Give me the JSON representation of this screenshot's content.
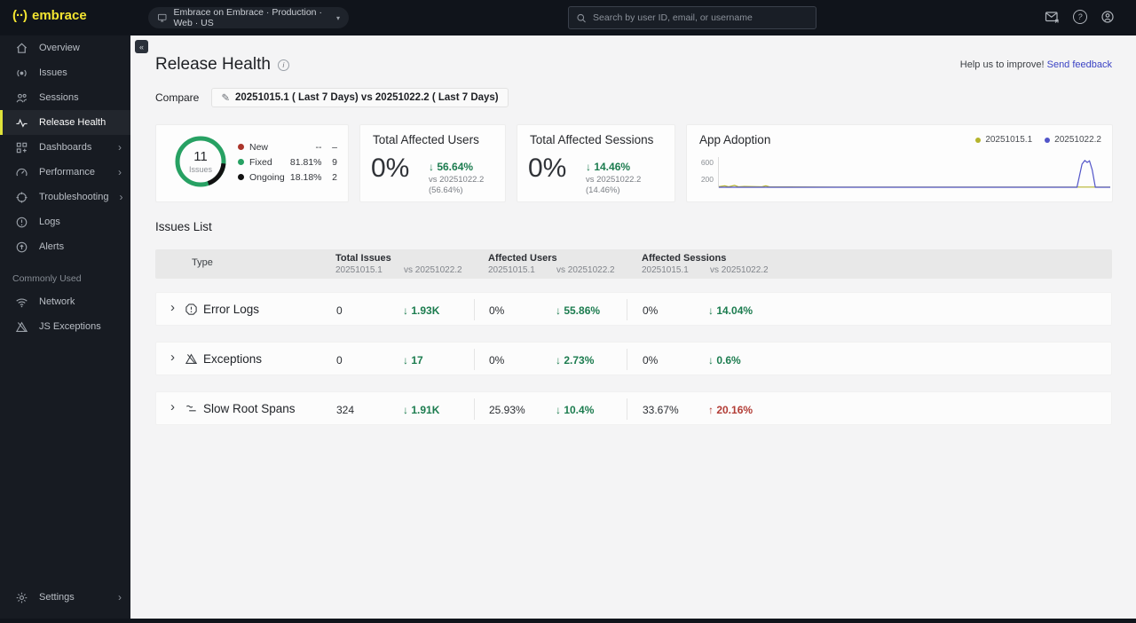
{
  "ui": {
    "chevron_glyph": "›",
    "collapse_glyph": "«",
    "pencil_glyph": "✎",
    "help_glyph": "?",
    "info_glyph": "i",
    "caret_glyph": "▾"
  },
  "topbar": {
    "logo_mark": "(··)",
    "logo_text": "embrace",
    "app_selector_text": "Embrace on Embrace · Production · Web · US",
    "search_placeholder": "Search by user ID, email, or username"
  },
  "sidebar": {
    "items": [
      {
        "label": "Overview",
        "icon": "home-icon"
      },
      {
        "label": "Issues",
        "icon": "radar-icon"
      },
      {
        "label": "Sessions",
        "icon": "users-icon"
      },
      {
        "label": "Release Health",
        "icon": "pulse-icon",
        "active": true
      },
      {
        "label": "Dashboards",
        "icon": "dashboards-grid-icon",
        "chevron": true
      },
      {
        "label": "Performance",
        "icon": "gauge-icon",
        "chevron": true
      },
      {
        "label": "Troubleshooting",
        "icon": "crosshair-icon",
        "chevron": true
      },
      {
        "label": "Logs",
        "icon": "alert-circle-icon"
      },
      {
        "label": "Alerts",
        "icon": "alert-target-icon"
      }
    ],
    "section_label": "Commonly Used",
    "common_items": [
      {
        "label": "Network",
        "icon": "wifi-icon"
      },
      {
        "label": "JS Exceptions",
        "icon": "warning-triangle-icon"
      }
    ],
    "settings_label": "Settings"
  },
  "page": {
    "title": "Release Health",
    "feedback_text": "Help us to improve!",
    "feedback_link": "Send feedback",
    "compare_label": "Compare",
    "compare_value": "20251015.1 ( Last 7 Days) vs 20251022.2 ( Last 7 Days)"
  },
  "cards": {
    "issues": {
      "center_value": "11",
      "center_label": "Issues",
      "legend": [
        {
          "label": "New",
          "pct": "--",
          "count": "–",
          "color": "#ab352b"
        },
        {
          "label": "Fixed",
          "pct": "81.81%",
          "count": "9",
          "color": "#27a163"
        },
        {
          "label": "Ongoing",
          "pct": "18.18%",
          "count": "2",
          "color": "#121212"
        }
      ]
    },
    "affected_users": {
      "title": "Total Affected Users",
      "value": "0%",
      "delta": "↓ 56.64%",
      "vs": "vs 20251022.2 (56.64%)"
    },
    "affected_sessions": {
      "title": "Total Affected Sessions",
      "value": "0%",
      "delta": "↓ 14.46%",
      "vs": "vs 20251022.2 (14.46%)"
    },
    "app_adoption": {
      "title": "App Adoption",
      "legend": [
        {
          "label": "20251015.1",
          "color": "#b5b42c"
        },
        {
          "label": "20251022.2",
          "color": "#5154c8"
        }
      ],
      "y_ticks": [
        "600",
        "200"
      ]
    }
  },
  "chart_data": {
    "type": "line",
    "title": "App Adoption",
    "xlabel": "",
    "ylabel": "",
    "ylim": [
      0,
      700
    ],
    "y_ticks": [
      200,
      600
    ],
    "grid": false,
    "legend_position": "top-right",
    "series": [
      {
        "name": "20251015.1",
        "color": "#b5b42c",
        "points": [
          [
            0,
            25
          ],
          [
            1.5,
            45
          ],
          [
            2.5,
            20
          ],
          [
            4,
            55
          ],
          [
            5,
            20
          ],
          [
            6.5,
            30
          ],
          [
            11,
            20
          ],
          [
            12,
            45
          ],
          [
            13,
            18
          ],
          [
            30,
            14
          ],
          [
            60,
            14
          ],
          [
            100,
            14
          ]
        ]
      },
      {
        "name": "20251022.2",
        "color": "#5154c8",
        "points": [
          [
            0,
            10
          ],
          [
            50,
            10
          ],
          [
            91.5,
            10
          ],
          [
            92.8,
            560
          ],
          [
            93.5,
            645
          ],
          [
            94.1,
            600
          ],
          [
            94.7,
            635
          ],
          [
            95.4,
            420
          ],
          [
            96.2,
            10
          ],
          [
            100,
            10
          ]
        ]
      }
    ]
  },
  "issues_list": {
    "title": "Issues List",
    "header": {
      "type": "Type",
      "groups": [
        {
          "label": "Total Issues",
          "col1": "20251015.1",
          "col2": "vs 20251022.2"
        },
        {
          "label": "Affected Users",
          "col1": "20251015.1",
          "col2": "vs 20251022.2"
        },
        {
          "label": "Affected Sessions",
          "col1": "20251015.1",
          "col2": "vs 20251022.2"
        }
      ]
    },
    "rows": [
      {
        "label": "Error Logs",
        "icon": "error-octagon-icon",
        "total": "0",
        "total_delta": "↓ 1.93K",
        "users": "0%",
        "users_delta": "↓ 55.86%",
        "sessions": "0%",
        "sessions_delta": "↓ 14.04%"
      },
      {
        "label": "Exceptions",
        "icon": "warning-triangle-icon",
        "total": "0",
        "total_delta": "↓ 17",
        "users": "0%",
        "users_delta": "↓ 2.73%",
        "sessions": "0%",
        "sessions_delta": "↓ 0.6%"
      },
      {
        "label": "Slow Root Spans",
        "icon": "spans-icon",
        "total": "324",
        "total_delta": "↓ 1.91K",
        "users": "25.93%",
        "users_delta": "↓ 10.4%",
        "sessions": "33.67%",
        "sessions_delta": "↑ 20.16%"
      }
    ]
  },
  "colors": {
    "accent_yellow": "#f3e531",
    "green": "#1c7c4f",
    "red": "#b23c35",
    "link_blue": "#3b43c4",
    "donut_green": "#27a163"
  }
}
